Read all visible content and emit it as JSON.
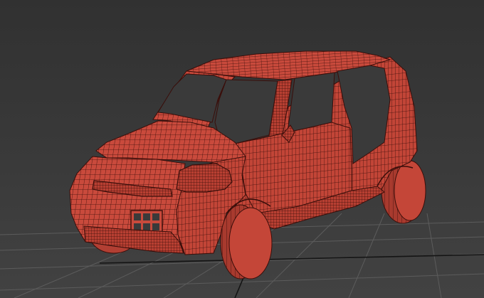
{
  "viewport": {
    "view": "perspective",
    "background_color": "#383838",
    "grid_color": "#5c5c5c",
    "grid_axis_color": "#141414"
  },
  "model": {
    "name": "car-wireframe-model",
    "render_mode": "wireframe-shaded",
    "shade_color": "#c94a3c",
    "wire_color": "#3a0e0a",
    "window_color": "#3a3a3a",
    "tire_color": "#c44638"
  }
}
